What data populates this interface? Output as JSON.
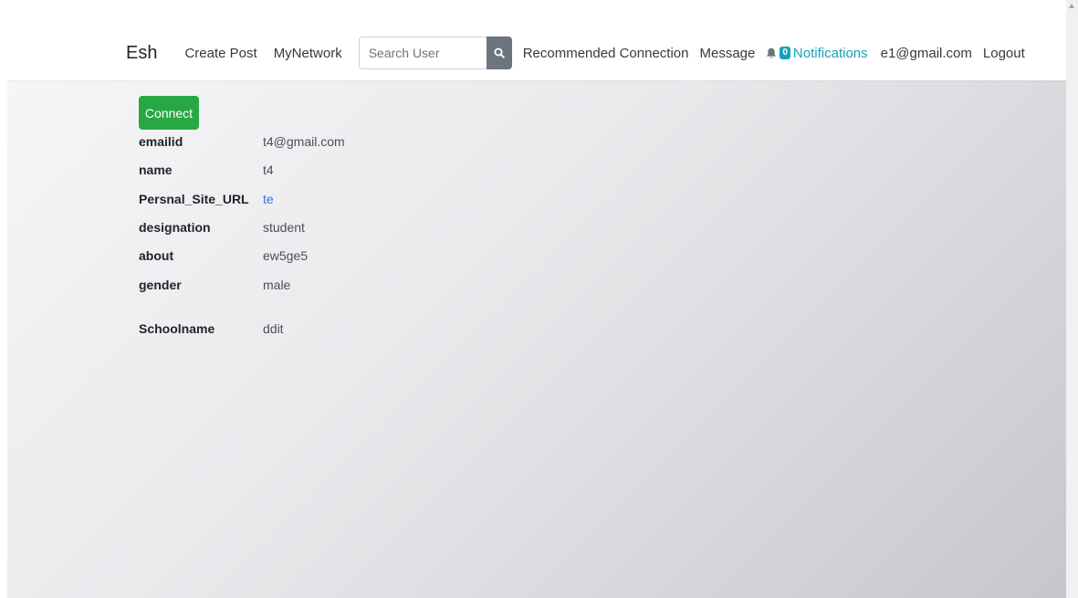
{
  "navbar": {
    "brand": "Esh",
    "links": {
      "create_post": "Create Post",
      "my_network": "MyNetwork",
      "recommended_connection": "Recommended Connection",
      "message": "Message",
      "notifications": "Notifications",
      "user_email": "e1@gmail.com",
      "logout": "Logout"
    },
    "search": {
      "placeholder": "Search User",
      "value": "",
      "icon": "search-icon"
    },
    "notification_badge": "0",
    "notification_icon": "bell-icon"
  },
  "profile": {
    "connect_label": "Connect",
    "fields": [
      {
        "key": "emailid",
        "value": "t4@gmail.com"
      },
      {
        "key": "name",
        "value": "t4"
      },
      {
        "key": "Persnal_Site_URL",
        "value": "te"
      },
      {
        "key": "designation",
        "value": "student"
      },
      {
        "key": "about",
        "value": "ew5ge5"
      },
      {
        "key": "gender",
        "value": "male"
      },
      {
        "key": "Schoolname",
        "value": "ddit"
      }
    ]
  },
  "colors": {
    "connect_button": "#28a745",
    "search_button": "#6c757d",
    "badge": "#17a2b8",
    "link": "#2a7be0"
  }
}
